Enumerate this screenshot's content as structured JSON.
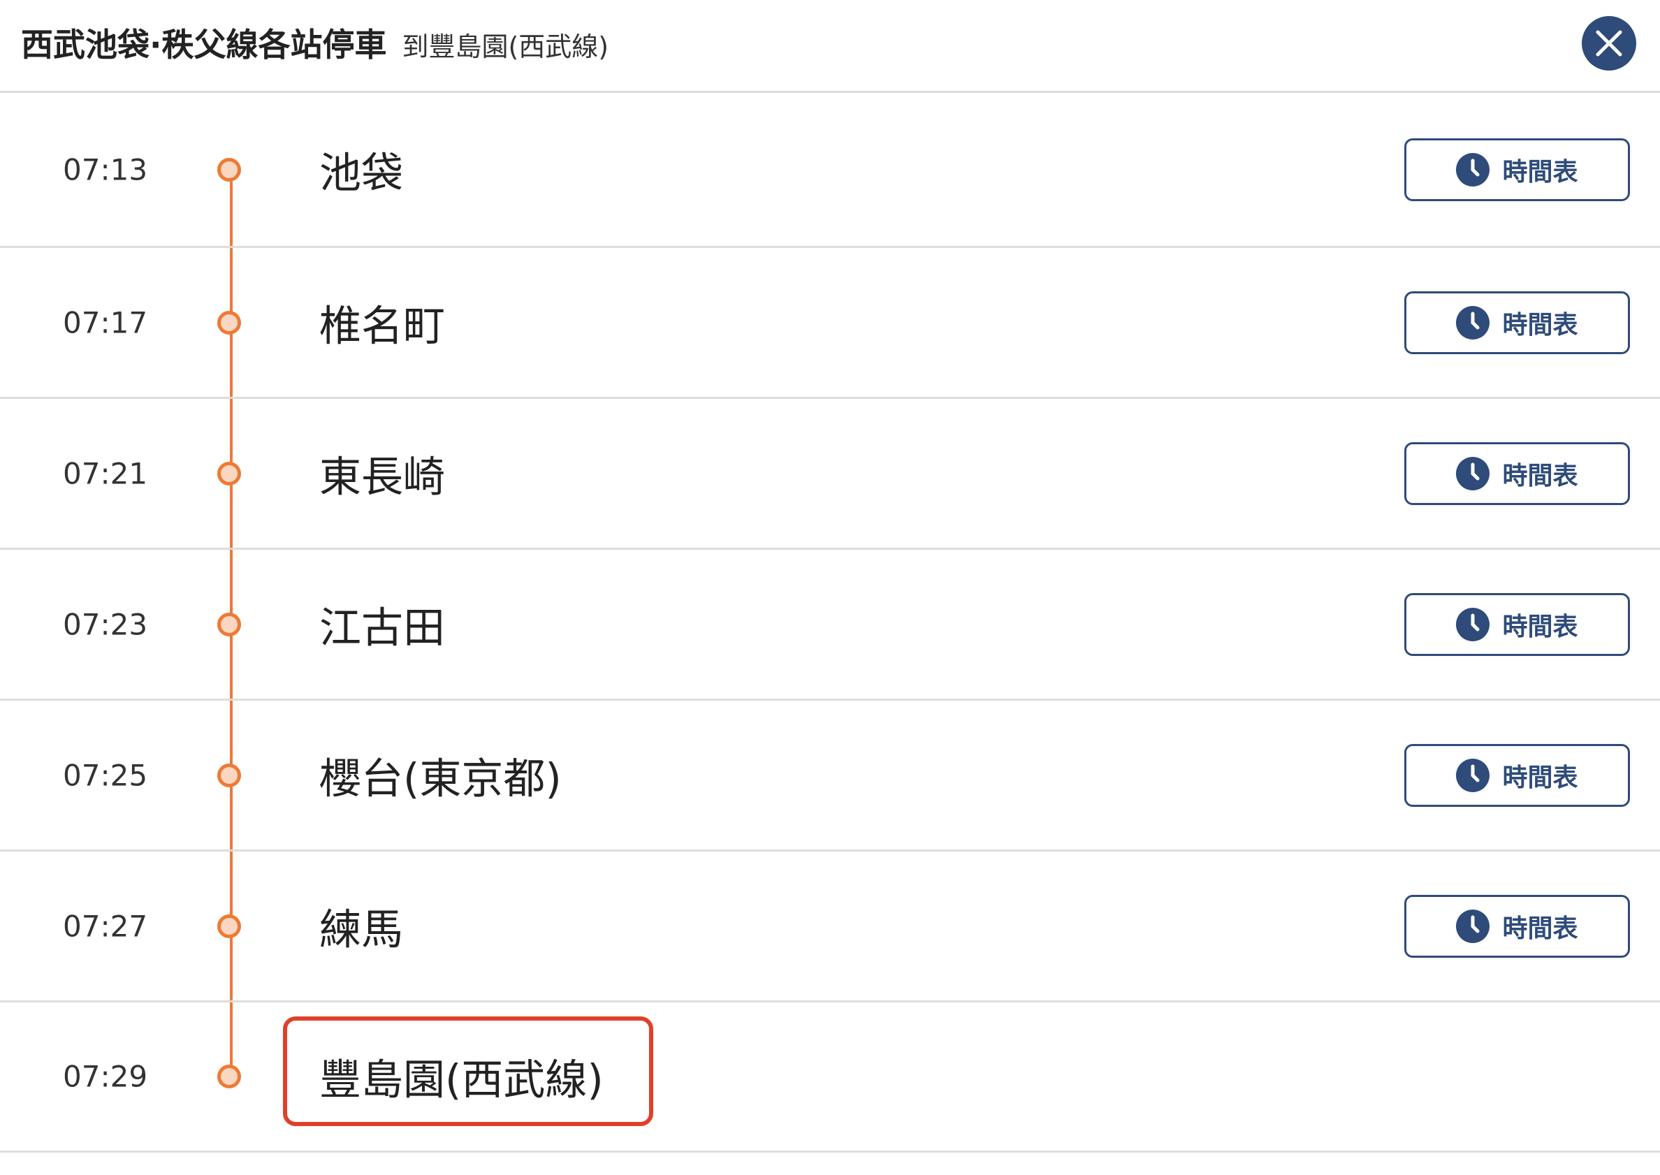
{
  "header": {
    "title": "西武池袋·秩父線各站停車",
    "destination": "到豐島園(西武線)"
  },
  "colors": {
    "accent": "#ee7a34",
    "dot_fill": "#fbd7c2",
    "button": "#2e4b7a",
    "highlight": "#e0402a"
  },
  "stops": [
    {
      "time": "07:13",
      "station": "池袋",
      "button": "時間表"
    },
    {
      "time": "07:17",
      "station": "椎名町",
      "button": "時間表"
    },
    {
      "time": "07:21",
      "station": "東長崎",
      "button": "時間表"
    },
    {
      "time": "07:23",
      "station": "江古田",
      "button": "時間表"
    },
    {
      "time": "07:25",
      "station": "櫻台(東京都)",
      "button": "時間表"
    },
    {
      "time": "07:27",
      "station": "練馬",
      "button": "時間表"
    },
    {
      "time": "07:29",
      "station": "豐島園(西武線)"
    }
  ]
}
